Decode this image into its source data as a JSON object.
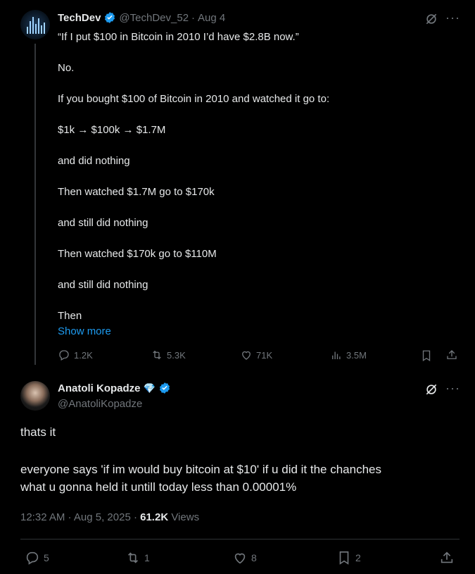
{
  "first_tweet": {
    "display_name": "TechDev",
    "handle": "@TechDev_52",
    "separator": "·",
    "date": "Aug 4",
    "lines": [
      "“If I put $100 in Bitcoin in 2010 I’d have $2.8B now.”",
      "No.",
      "If you bought $100 of Bitcoin in 2010 and watched it go to:",
      "$1k → $100k → $1.7M",
      "and did nothing",
      "Then watched $1.7M go to $170k",
      "and still did nothing",
      "Then watched $170k go to $110M",
      "and still did nothing",
      "Then"
    ],
    "show_more": "Show more",
    "replies": "1.2K",
    "reposts": "5.3K",
    "likes": "71K",
    "views": "3.5M"
  },
  "reply": {
    "display_name": "Anatoli Kopadze",
    "emoji": "💎",
    "handle": "@AnatoliKopadze",
    "line1": "thats it",
    "line2": "everyone says 'if im would buy bitcoin at $10' if u did it the chanches",
    "line3": "what u gonna held it untill today less than 0.00001%",
    "timestamp": "12:32 AM · Aug 5, 2025 · ",
    "views_count": "61.2K",
    "views_label": " Views",
    "replies": "5",
    "reposts": "1",
    "likes": "8",
    "bookmarks": "2"
  },
  "colors": {
    "link": "#1d9bf0",
    "muted": "#71767b",
    "text": "#e7e9ea",
    "verified": "#1d9bf0"
  }
}
